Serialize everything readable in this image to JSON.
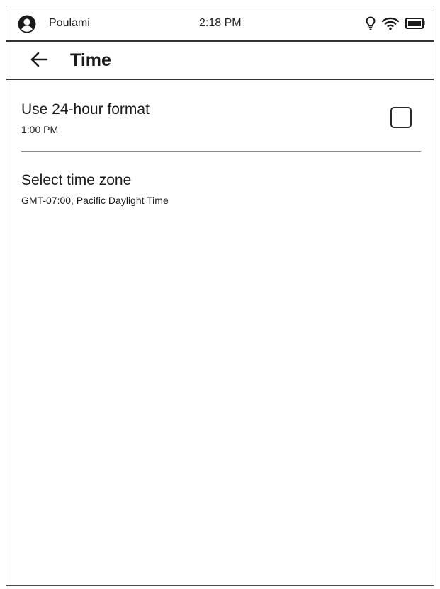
{
  "status_bar": {
    "user_name": "Poulami",
    "time": "2:18 PM",
    "icons": [
      "avatar-icon",
      "light-bulb-icon",
      "wifi-icon",
      "battery-icon"
    ]
  },
  "header": {
    "back_icon": "arrow-left-icon",
    "title": "Time"
  },
  "settings": {
    "use_24_hour": {
      "label": "Use 24-hour format",
      "subtitle": "1:00 PM",
      "checked": false
    },
    "time_zone": {
      "label": "Select time zone",
      "subtitle": "GMT-07:00, Pacific Daylight Time"
    }
  }
}
